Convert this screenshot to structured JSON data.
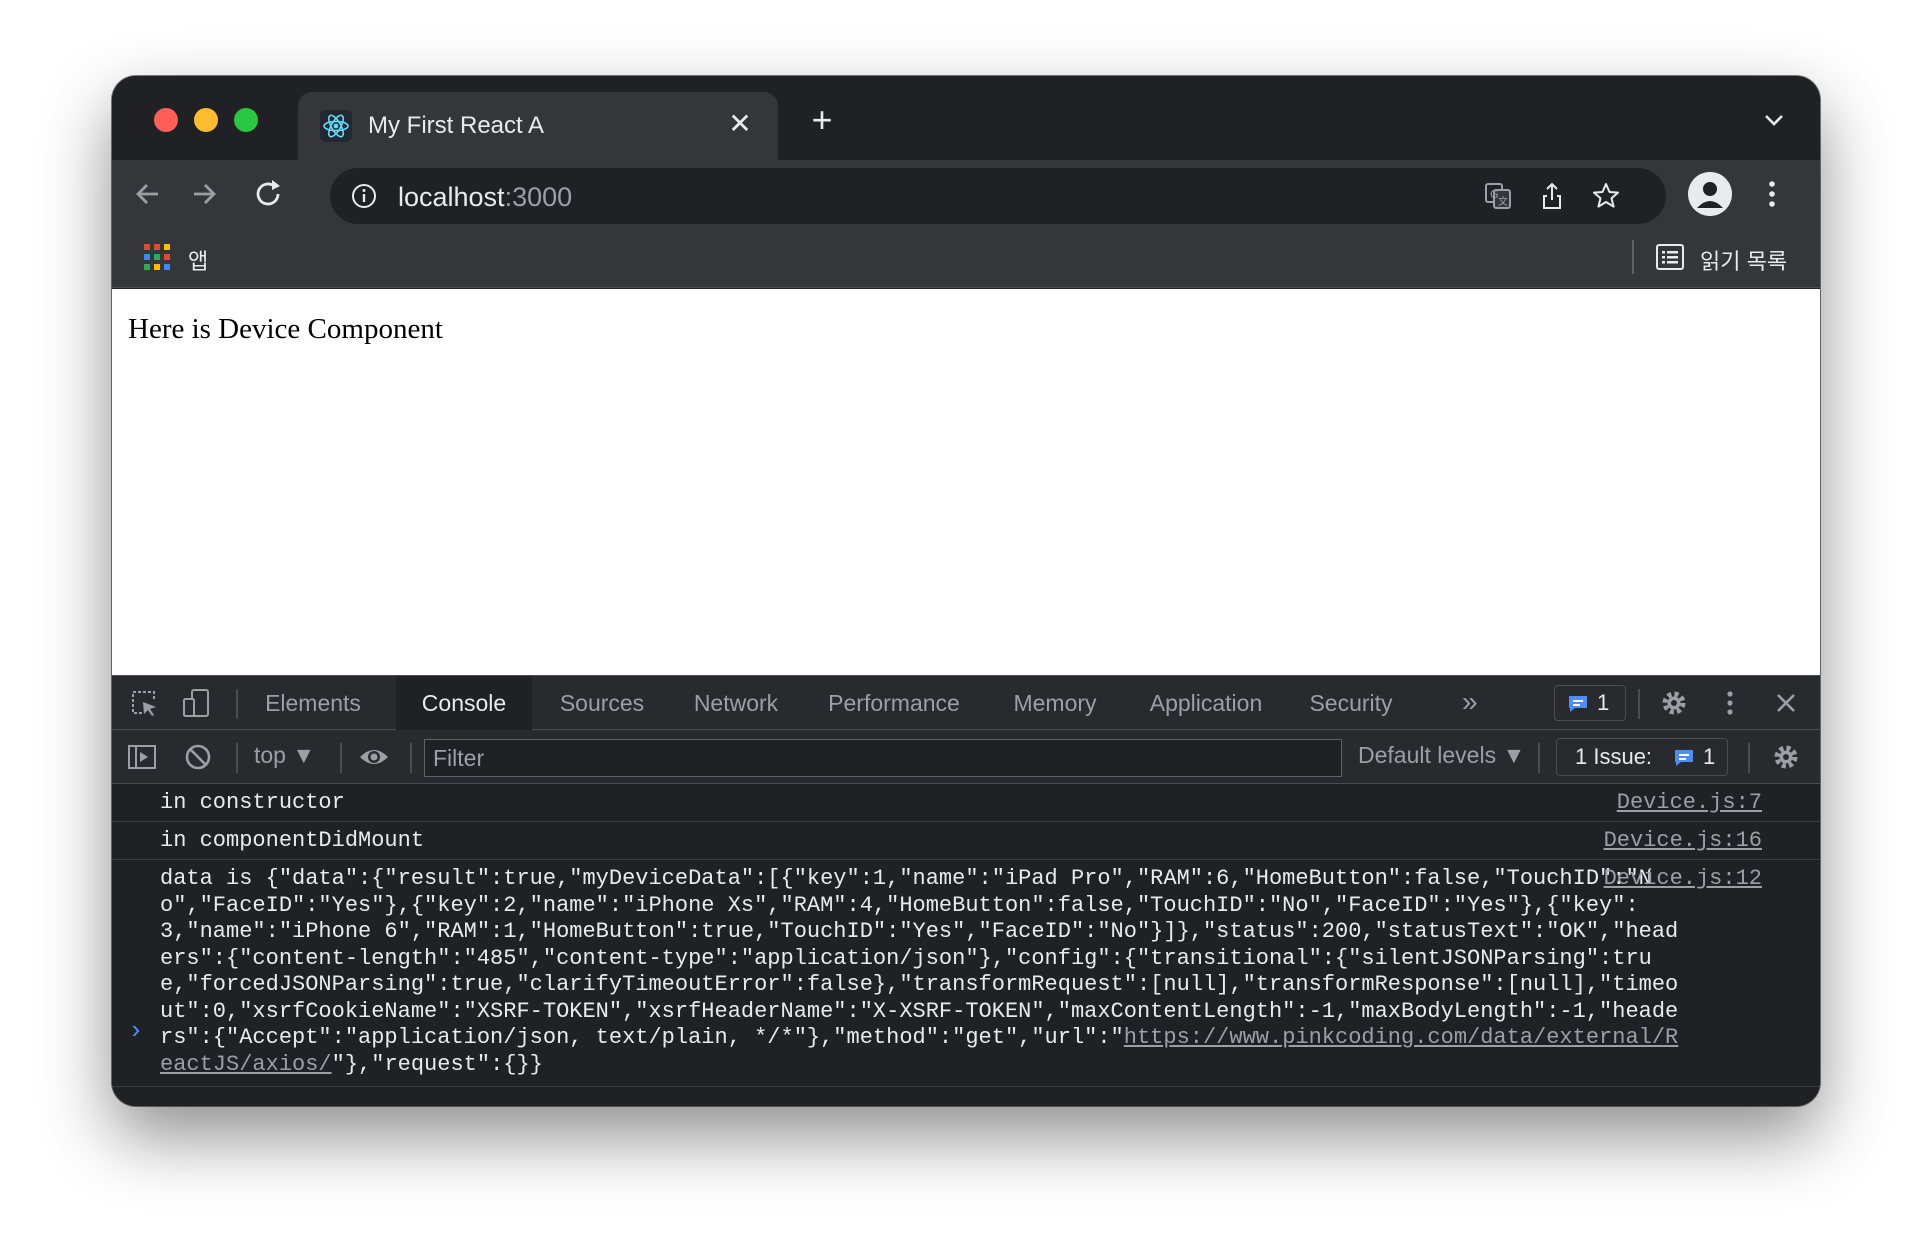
{
  "browser": {
    "tab_title": "My First React A",
    "tab_close": "✕",
    "new_tab": "+",
    "url_host": "localhost",
    "url_port": ":3000",
    "bookmarks": {
      "apps_label": "앱",
      "reading_list_label": "읽기 목록"
    }
  },
  "page": {
    "heading": "Here is Device Component"
  },
  "devtools": {
    "tabs": [
      "Elements",
      "Console",
      "Sources",
      "Network",
      "Performance",
      "Memory",
      "Application",
      "Security"
    ],
    "active_tab": "Console",
    "more_tabs": "»",
    "issues_count": "1",
    "context": "top",
    "filter_placeholder": "Filter",
    "levels": "Default levels",
    "issue_label": "1 Issue:",
    "issue_count": "1",
    "prompt": "›"
  },
  "console": {
    "messages": [
      {
        "text": "in constructor",
        "source": "Device.js:7"
      },
      {
        "text": "in componentDidMount",
        "source": "Device.js:16"
      },
      {
        "text_before": "data is {\"data\":{\"result\":true,\"myDeviceData\":[{\"key\":1,\"name\":\"iPad Pro\",\"RAM\":6,\"HomeButton\":false,\"TouchID\":\"No\",\"FaceID\":\"Yes\"},{\"key\":2,\"name\":\"iPhone Xs\",\"RAM\":4,\"HomeButton\":false,\"TouchID\":\"No\",\"FaceID\":\"Yes\"},{\"key\":3,\"name\":\"iPhone 6\",\"RAM\":1,\"HomeButton\":true,\"TouchID\":\"Yes\",\"FaceID\":\"No\"}]},\"status\":200,\"statusText\":\"OK\",\"headers\":{\"content-length\":\"485\",\"content-type\":\"application/json\"},\"config\":{\"transitional\":{\"silentJSONParsing\":true,\"forcedJSONParsing\":true,\"clarifyTimeoutError\":false},\"transformRequest\":[null],\"transformResponse\":[null],\"timeout\":0,\"xsrfCookieName\":\"XSRF-TOKEN\",\"xsrfHeaderName\":\"X-XSRF-TOKEN\",\"maxContentLength\":-1,\"maxBodyLength\":-1,\"headers\":{\"Accept\":\"application/json, text/plain, */*\"},\"method\":\"get\",\"url\":\"",
        "link": "https://www.pinkcoding.com/data/external/ReactJS/axios/",
        "text_after": "\"},\"request\":{}}",
        "source": "Device.js:12"
      }
    ]
  }
}
